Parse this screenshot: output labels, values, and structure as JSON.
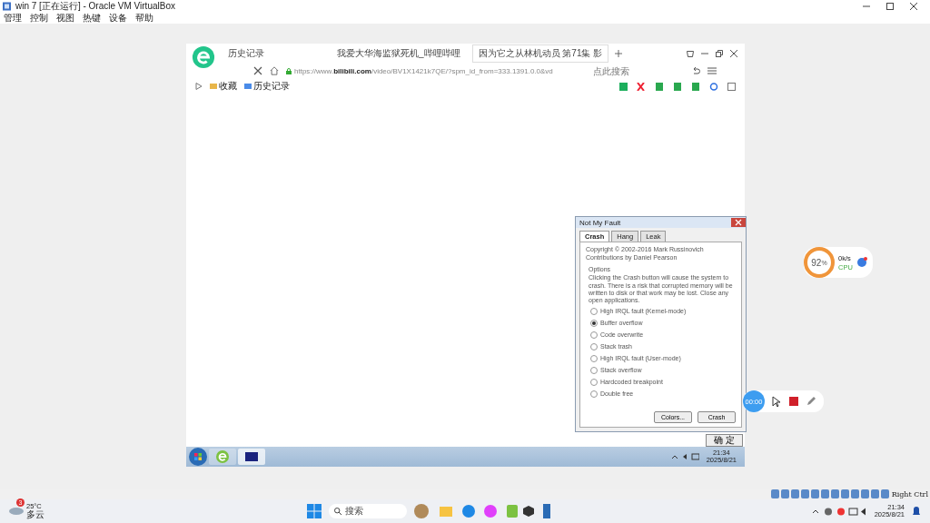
{
  "host_window": {
    "title": "win 7 [正在运行] - Oracle VM VirtualBox",
    "menu": [
      "管理",
      "控制",
      "视图",
      "热键",
      "设备",
      "帮助"
    ]
  },
  "browser": {
    "tabs": [
      {
        "label": "历史记录",
        "selected": false
      },
      {
        "label": "我爱大华海监狱死机_哔哩哔哩",
        "selected": false
      },
      {
        "label": "因为它之从林机动员 第71集 影",
        "selected": true
      }
    ],
    "url_scheme": "https://www.",
    "url_domain": "bilibili.com",
    "url_path": "/video/BV1X1421k7QE/?spm_id_from=333.1391.0.0&vd",
    "search": {
      "placeholder": "点此搜索"
    },
    "bookmarks": [
      "收藏",
      "历史记录"
    ]
  },
  "dialog": {
    "title": "Not My Fault",
    "tabs": [
      {
        "label": "Crash",
        "selected": true
      },
      {
        "label": "Hang",
        "selected": false
      },
      {
        "label": "Leak",
        "selected": false
      }
    ],
    "copyright": [
      "Copyright © 2002-2016 Mark Russinovich",
      "Contributions by Daniel Pearson"
    ],
    "options_label": "Options",
    "description": "Clicking the Crash button will cause the system to crash. There is a risk that corrupted memory will be written to disk or that work may be lost. Close any open applications.",
    "options": [
      {
        "label": "High IRQL fault (Kernel-mode)",
        "selected": false
      },
      {
        "label": "Buffer overflow",
        "selected": true
      },
      {
        "label": "Code overwrite",
        "selected": false
      },
      {
        "label": "Stack trash",
        "selected": false
      },
      {
        "label": "High IRQL fault (User-mode)",
        "selected": false
      },
      {
        "label": "Stack overflow",
        "selected": false
      },
      {
        "label": "Hardcoded breakpoint",
        "selected": false
      },
      {
        "label": "Double free",
        "selected": false
      }
    ],
    "buttons": [
      "Colors...",
      "Crash"
    ],
    "behind_button": "确 定"
  },
  "guest_taskbar": {
    "time": "21:34",
    "date": "2025/8/21"
  },
  "monitor_widget": {
    "percent": "92",
    "unit": "%",
    "speed": "0k/s",
    "cpu": "CPU"
  },
  "recorder": {
    "time": "00:00"
  },
  "host_status": {
    "key": "Right Ctrl"
  },
  "host_taskbar": {
    "weather_badge": "3",
    "temperature": "25°C",
    "weather": "多云",
    "search": "搜索",
    "time": "21:34",
    "date": "2025/8/21"
  }
}
